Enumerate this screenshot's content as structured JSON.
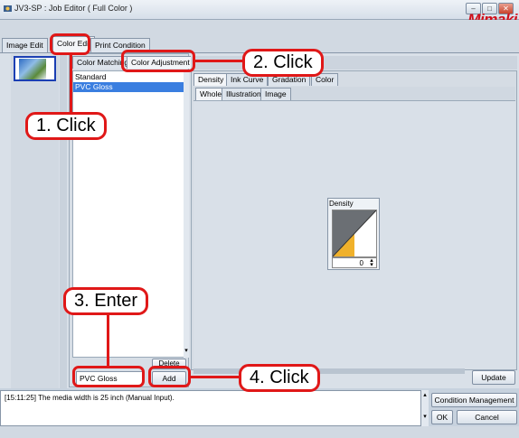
{
  "window": {
    "title": "JV3-SP : Job Editor ( Full Color )",
    "brand_logo": "Mimaki",
    "buttons": [
      "–",
      "□",
      "✕"
    ]
  },
  "main_tabs": [
    "Image Edit",
    "Color Edit",
    "Print Condition"
  ],
  "sub_tabs": [
    "Color Matching",
    "Color Adjustment"
  ],
  "right_tabs": [
    "Density",
    "Ink Curve",
    "Gradation",
    "Color"
  ],
  "view_tabs": [
    "Whole",
    "Illustration",
    "Image"
  ],
  "list": {
    "items": [
      "Standard",
      "PVC Gloss"
    ],
    "selected_index": 1
  },
  "density": {
    "label": "Density",
    "value": "0"
  },
  "buttons": {
    "delete": "Delete",
    "add": "Add",
    "update": "Update",
    "condition_management": "Condition Management",
    "ok": "OK",
    "cancel": "Cancel"
  },
  "name_input": {
    "value": "PVC Gloss"
  },
  "log": {
    "message": "[15:11:25] The media width is 25 inch (Manual Input)."
  },
  "callouts": {
    "c1": "1. Click",
    "c2": "2. Click",
    "c3": "3. Enter",
    "c4": "4. Click"
  },
  "colors": {
    "callout_red": "#e01818",
    "selection_blue": "#3a7ee0",
    "density_orange": "#f0b12b",
    "logo_red": "#d0101c"
  }
}
